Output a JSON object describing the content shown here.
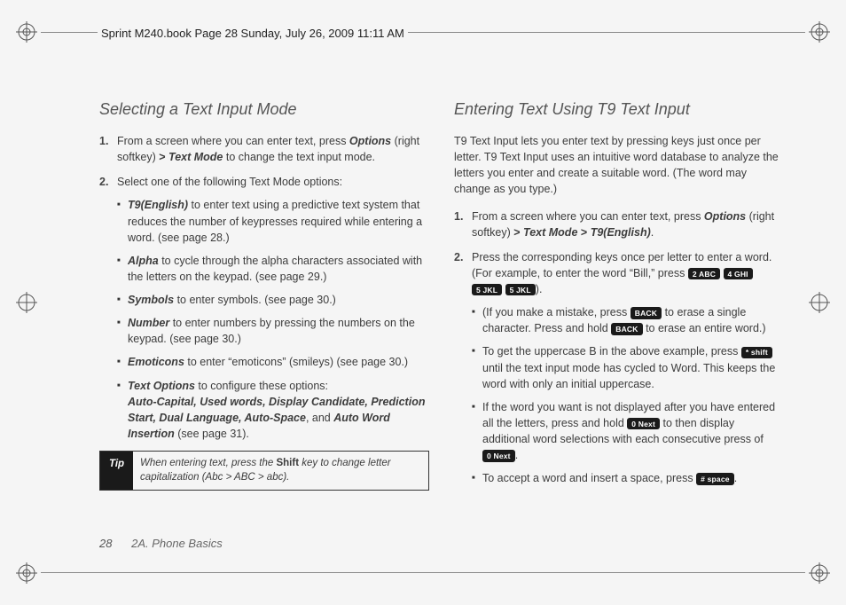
{
  "header": "Sprint M240.book  Page 28  Sunday, July 26, 2009  11:11 AM",
  "left": {
    "title": "Selecting a Text Input Mode",
    "step1_a": "From a screen where you can enter text, press ",
    "step1_b": "Options",
    "step1_c": " (right softkey) ",
    "gt": ">",
    "step1_d": " Text Mode",
    "step1_e": " to change the text input mode.",
    "step2": "Select one of the following Text Mode options:",
    "opts": {
      "t9_label": "T9(English)",
      "t9_text": " to enter text using a predictive text system that reduces the number of keypresses required while entering a word. (see page 28.)",
      "alpha_label": "Alpha",
      "alpha_text": " to cycle through the alpha characters associated with the letters on the keypad. (see page 29.)",
      "symbols_label": "Symbols",
      "symbols_text": " to enter symbols. (see page 30.)",
      "number_label": "Number",
      "number_text": " to enter numbers by pressing the numbers on the keypad. (see page 30.)",
      "emoticons_label": "Emoticons",
      "emoticons_text": " to enter “emoticons” (smileys) (see page 30.)",
      "textopt_label": "Text Options",
      "textopt_text": " to configure these options: ",
      "textopt_items": "Auto-Capital, Used words, Display Candidate, Prediction Start, Dual Language, Auto-Space",
      "textopt_and": ", and ",
      "textopt_last": "Auto Word Insertion",
      "textopt_post": " (see page 31)."
    },
    "tip": {
      "label": "Tip",
      "body_a": "When entering text, press the ",
      "body_shift": "Shift",
      "body_b": " key to change letter capitalization (Abc > ABC > abc)."
    }
  },
  "right": {
    "title": "Entering Text Using T9 Text Input",
    "intro": "T9 Text Input lets you enter text by pressing keys just once per letter. T9 Text Input uses an intuitive word database to analyze the letters you enter and create a suitable word. (The word may change as you type.)",
    "step1_a": "From a screen where you can enter text, press ",
    "step1_b": "Options",
    "step1_c": " (right softkey) ",
    "gt1": ">",
    "step1_d": "Text Mode",
    "gt2": ">",
    "step1_e": "T9(English)",
    "step1_f": ".",
    "step2_a": "Press the corresponding keys once per letter to enter a word. (For example, to enter the word “Bill,” press ",
    "key2": "2 ABC",
    "key4": "4 GHI",
    "key5a": "5 JKL",
    "key5b": "5 JKL",
    "step2_b": ").",
    "sub_mistake_a": "(If you make a mistake, press ",
    "keyback1": "BACK",
    "sub_mistake_b": " to erase a single character. Press and hold ",
    "keyback2": "BACK",
    "sub_mistake_c": " to erase an entire word.)",
    "sub_upper_a": "To get the uppercase B in the above example, press ",
    "keyshift": "* shift",
    "sub_upper_b": " until the text input mode has cycled to Word. This keeps the word with only an initial uppercase.",
    "sub_notdisp_a": "If the word you want is not displayed after you have entered all the letters, press and hold ",
    "keynext1": "0 Next",
    "sub_notdisp_b": " to then display additional word selections with each consecutive press of ",
    "keynext2": "0 Next",
    "sub_notdisp_c": ".",
    "sub_accept_a": "To accept a word and insert a space, press ",
    "keyspace": "# space",
    "sub_accept_b": "."
  },
  "footer": {
    "page": "28",
    "section": "2A. Phone Basics"
  }
}
